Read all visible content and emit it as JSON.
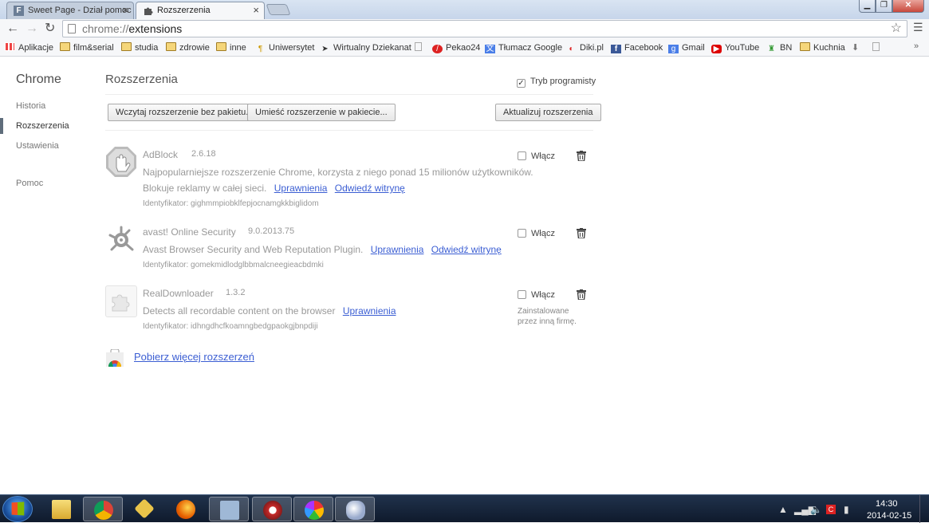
{
  "browser": {
    "tabs": [
      {
        "label": "Sweet Page - Dział pomoc",
        "icon": "f-favicon",
        "active": false
      },
      {
        "label": "Rozszerzenia",
        "icon": "puzzle-icon",
        "active": true
      }
    ],
    "url_scheme": "chrome://",
    "url_path": "extensions"
  },
  "bookmarks": [
    {
      "label": "Aplikacje",
      "icon": "apps-grid-icon"
    },
    {
      "label": "film&serial",
      "icon": "folder-icon"
    },
    {
      "label": "studia",
      "icon": "folder-icon"
    },
    {
      "label": "zdrowie",
      "icon": "folder-icon"
    },
    {
      "label": "inne",
      "icon": "folder-icon"
    },
    {
      "label": "Uniwersytet",
      "icon": "page-icon"
    },
    {
      "label": "Wirtualny Dziekanat",
      "icon": "arrow-icon"
    },
    {
      "label": "",
      "icon": "page-icon"
    },
    {
      "label": "Pekao24",
      "icon": "pekao-icon"
    },
    {
      "label": "Tłumacz Google",
      "icon": "translate-icon"
    },
    {
      "label": "Diki.pl",
      "icon": "diki-icon"
    },
    {
      "label": "Facebook",
      "icon": "facebook-icon"
    },
    {
      "label": "Gmail",
      "icon": "gmail-icon"
    },
    {
      "label": "YouTube",
      "icon": "youtube-icon"
    },
    {
      "label": "BN",
      "icon": "bn-icon"
    },
    {
      "label": "Kuchnia",
      "icon": "folder-icon"
    }
  ],
  "sidebar": {
    "title": "Chrome",
    "items": [
      "Historia",
      "Rozszerzenia",
      "Ustawienia",
      "Pomoc"
    ],
    "active": "Rozszerzenia"
  },
  "main": {
    "title": "Rozszerzenia",
    "dev_mode_label": "Tryb programisty",
    "dev_mode_checked": true,
    "buttons": {
      "load": "Wczytaj rozszerzenie bez pakietu...",
      "pack": "Umieść rozszerzenie w pakiecie...",
      "update": "Aktualizuj rozszerzenia"
    },
    "extensions": [
      {
        "name": "AdBlock",
        "version": "2.6.18",
        "description_line1": "Najpopularniejsze rozszerzenie Chrome, korzysta z niego ponad 15 milionów użytkowników.",
        "description_line2": "Blokuje reklamy w całej sieci.",
        "permissions_link": "Uprawnienia",
        "website_link": "Odwiedź witrynę",
        "id_label": "Identyfikator: gighmmpiobklfepjocnamgkkbiglidom",
        "enable_label": "Włącz",
        "icon": "adblock-hand-icon"
      },
      {
        "name": "avast! Online Security",
        "version": "9.0.2013.75",
        "description_line1": "Avast Browser Security and Web Reputation Plugin.",
        "permissions_link": "Uprawnienia",
        "website_link": "Odwiedź witrynę",
        "id_label": "Identyfikator: gomekmidlodglbbmalcneegieacbdmki",
        "enable_label": "Włącz",
        "icon": "avast-icon"
      },
      {
        "name": "RealDownloader",
        "version": "1.3.2",
        "description_line1": "Detects all recordable content on the browser",
        "permissions_link": "Uprawnienia",
        "id_label": "Identyfikator: idhngdhcfkoamngbedgpaokgjbnpdiji",
        "enable_label": "Włącz",
        "note_line1": "Zainstalowane",
        "note_line2": "przez inną firmę.",
        "icon": "puzzle-icon"
      }
    ],
    "get_more_link": "Pobierz więcej rozszerzeń"
  },
  "taskbar": {
    "time": "14:30",
    "date": "2014-02-15",
    "apps": [
      "windows-explorer-icon",
      "chrome-icon",
      "app-icon",
      "firefox-icon",
      "network-icon",
      "speed-icon",
      "picasa-icon",
      "paint-icon"
    ]
  },
  "colors": {
    "link": "#3b5ed3",
    "taskbar": "#16243a"
  }
}
